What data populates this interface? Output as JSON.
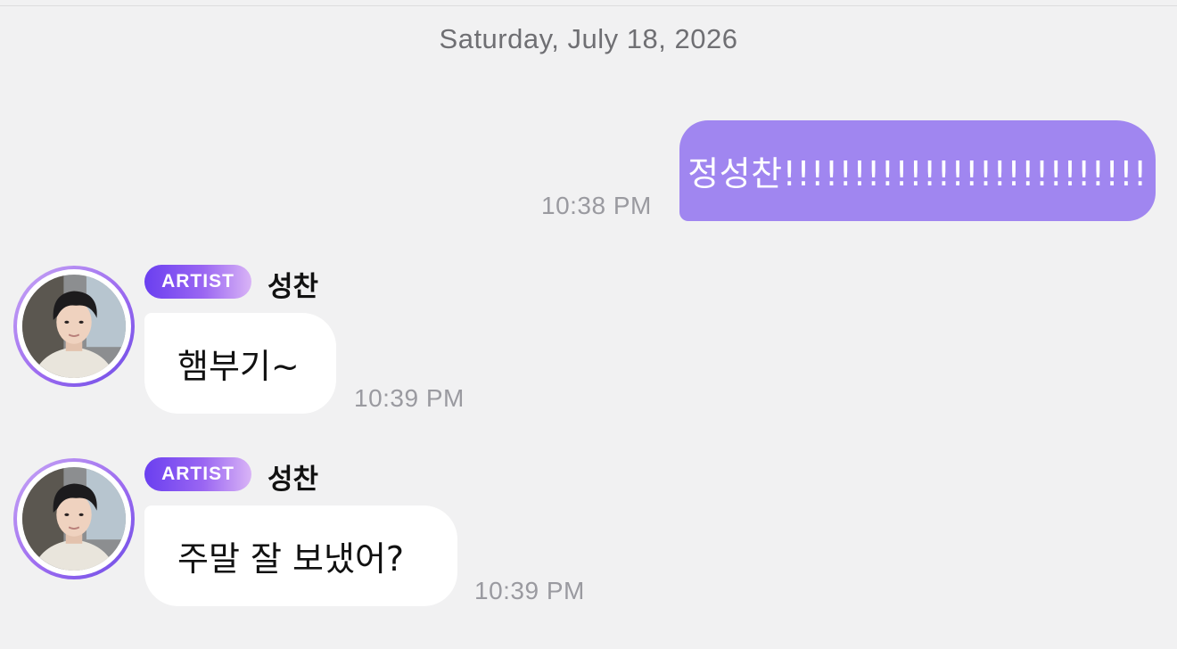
{
  "date_header": "Saturday, July 18, 2026",
  "messages": [
    {
      "direction": "outgoing",
      "text": "정성찬!!!!!!!!!!!!!!!!!!!!!!!!!!",
      "time": "10:38 PM"
    },
    {
      "direction": "incoming",
      "badge": "ARTIST",
      "sender": "성찬",
      "text": "햄부기~",
      "time": "10:39 PM"
    },
    {
      "direction": "incoming",
      "badge": "ARTIST",
      "sender": "성찬",
      "text": "주말 잘 보냈어?",
      "time": "10:39 PM"
    }
  ],
  "colors": {
    "background": "#f1f1f2",
    "outgoing_bubble": "#a086f0",
    "incoming_bubble": "#ffffff",
    "badge_gradient_start": "#6a3ff0",
    "badge_gradient_end": "#d9b4f6",
    "timestamp": "#9a9aa0"
  }
}
